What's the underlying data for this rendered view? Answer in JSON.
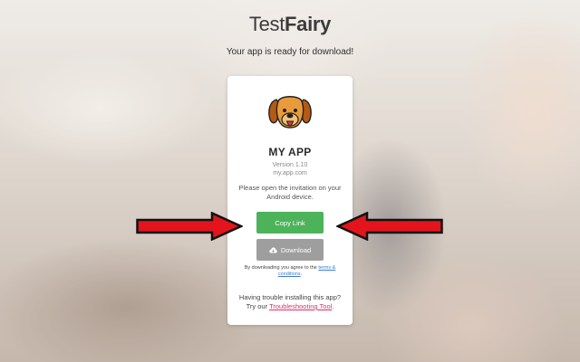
{
  "brand": {
    "part1": "Test",
    "part2": "Fairy"
  },
  "tagline": "Your app is ready for download!",
  "app": {
    "name": "MY APP",
    "version": "Version 1.10",
    "domain": "my.app.com",
    "icon": "dog-face-icon"
  },
  "instructions": "Please open the invitation on your Android device.",
  "buttons": {
    "copy_link": "Copy Link",
    "download": "Download",
    "download_icon": "cloud-download-icon"
  },
  "terms": {
    "prefix": "By downloading you agree to the ",
    "link": "terms & conditions",
    "suffix": "."
  },
  "trouble": {
    "line1": "Having trouble installing this app?",
    "prefix": "Try our ",
    "link": "Troubleshooting Tool",
    "suffix": "."
  },
  "colors": {
    "copy_button": "#4cb35a",
    "download_button": "#9e9e9e",
    "arrow_fill": "#e3141b",
    "trouble_link": "#d6336c",
    "terms_link": "#3a7bd5"
  }
}
